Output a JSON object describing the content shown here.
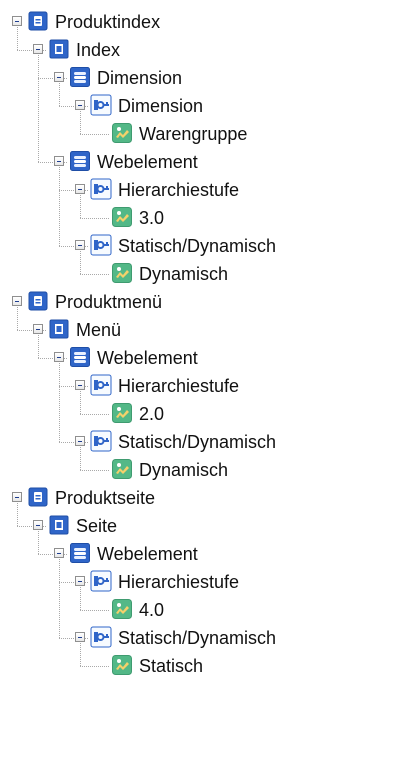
{
  "tree": {
    "nodes": [
      {
        "label": "Produktindex",
        "depth": 0,
        "icon": "database-icon"
      },
      {
        "label": "Index",
        "depth": 1,
        "icon": "index-icon"
      },
      {
        "label": "Dimension",
        "depth": 2,
        "icon": "stack-icon"
      },
      {
        "label": "Dimension",
        "depth": 3,
        "icon": "key-icon"
      },
      {
        "label": "Warengruppe",
        "depth": 4,
        "icon": "value-icon"
      },
      {
        "label": "Webelement",
        "depth": 2,
        "icon": "stack-icon"
      },
      {
        "label": "Hierarchiestufe",
        "depth": 3,
        "icon": "key-icon"
      },
      {
        "label": "3.0",
        "depth": 4,
        "icon": "value-icon"
      },
      {
        "label": "Statisch/Dynamisch",
        "depth": 3,
        "icon": "key-icon"
      },
      {
        "label": "Dynamisch",
        "depth": 4,
        "icon": "value-icon"
      },
      {
        "label": "Produktmenü",
        "depth": 0,
        "icon": "database-icon"
      },
      {
        "label": "Menü",
        "depth": 1,
        "icon": "index-icon"
      },
      {
        "label": "Webelement",
        "depth": 2,
        "icon": "stack-icon"
      },
      {
        "label": "Hierarchiestufe",
        "depth": 3,
        "icon": "key-icon"
      },
      {
        "label": "2.0",
        "depth": 4,
        "icon": "value-icon"
      },
      {
        "label": "Statisch/Dynamisch",
        "depth": 3,
        "icon": "key-icon"
      },
      {
        "label": "Dynamisch",
        "depth": 4,
        "icon": "value-icon"
      },
      {
        "label": "Produktseite",
        "depth": 0,
        "icon": "database-icon"
      },
      {
        "label": "Seite",
        "depth": 1,
        "icon": "index-icon"
      },
      {
        "label": "Webelement",
        "depth": 2,
        "icon": "stack-icon"
      },
      {
        "label": "Hierarchiestufe",
        "depth": 3,
        "icon": "key-icon"
      },
      {
        "label": "4.0",
        "depth": 4,
        "icon": "value-icon"
      },
      {
        "label": "Statisch/Dynamisch",
        "depth": 3,
        "icon": "key-icon"
      },
      {
        "label": "Statisch",
        "depth": 4,
        "icon": "value-icon"
      }
    ]
  },
  "colors": {
    "icon_blue": "#2f65c8",
    "icon_blue_dark": "#1f4ea6",
    "icon_green": "#53b887",
    "tree_line": "#a9a9a9",
    "expander_border": "#8f8f8f"
  }
}
